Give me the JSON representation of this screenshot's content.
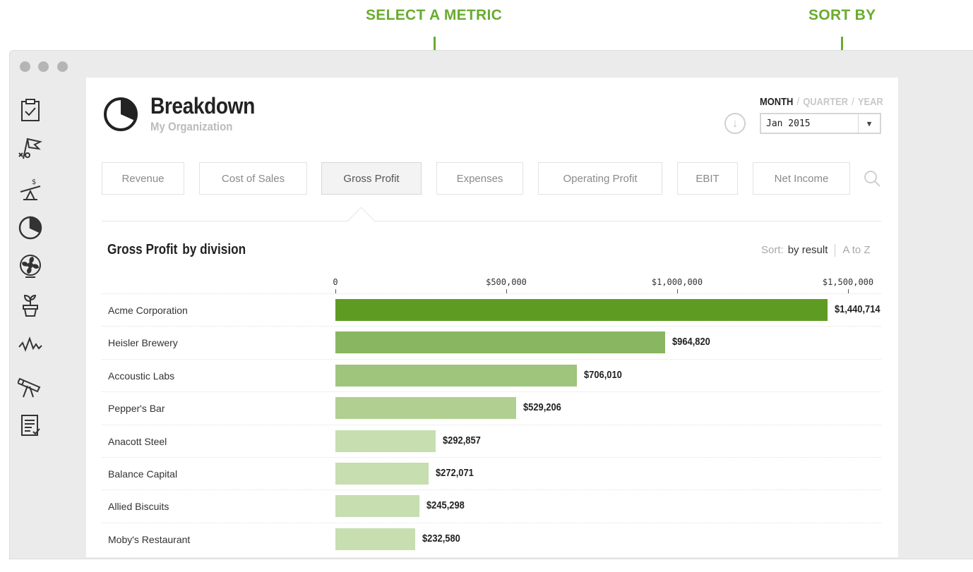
{
  "callouts": {
    "metric": "SELECT A  METRIC",
    "sort": "SORT BY"
  },
  "header": {
    "title": "Breakdown",
    "subtitle": "My Organization"
  },
  "period": {
    "month": "MONTH",
    "quarter": "QUARTER",
    "year": "YEAR",
    "separator": "/",
    "selected_date": "Jan 2015"
  },
  "tabs": [
    {
      "label": "Revenue",
      "active": false
    },
    {
      "label": "Cost of Sales",
      "active": false
    },
    {
      "label": "Gross Profit",
      "active": true
    },
    {
      "label": "Expenses",
      "active": false
    },
    {
      "label": "Operating Profit",
      "active": false
    },
    {
      "label": "EBIT",
      "active": false
    },
    {
      "label": "Net Income",
      "active": false
    }
  ],
  "section": {
    "metric": "Gross Profit",
    "by": "by division"
  },
  "sort": {
    "label": "Sort:",
    "current": "by result",
    "alternative": "A to Z"
  },
  "sidebar_icons": [
    "checklist-icon",
    "strategy-icon",
    "balance-icon",
    "pie-chart-icon",
    "fan-icon",
    "plant-icon",
    "pulse-icon",
    "telescope-icon",
    "report-icon"
  ],
  "colors": {
    "accent": "#6aab2e",
    "bar_shades": [
      "#5e9b23",
      "#89b661",
      "#9fc47c",
      "#b0cf90",
      "#c6deb0",
      "#c6deb0",
      "#c6deb0",
      "#c6deb0"
    ]
  },
  "chart_data": {
    "type": "bar",
    "orientation": "horizontal",
    "categories": [
      "Acme Corporation",
      "Heisler Brewery",
      "Accoustic Labs",
      "Pepper's Bar",
      "Anacott Steel",
      "Balance Capital",
      "Allied Biscuits",
      "Moby's Restaurant"
    ],
    "values": [
      1440714,
      964820,
      706010,
      529206,
      292857,
      272071,
      245298,
      232580
    ],
    "value_labels": [
      "$1,440,714",
      "$964,820",
      "$706,010",
      "$529,206",
      "$292,857",
      "$272,071",
      "$245,298",
      "$232,580"
    ],
    "ticks": [
      0,
      500000,
      1000000,
      1500000
    ],
    "tick_labels": [
      "0",
      "$500,000",
      "$1,000,000",
      "$1,500,000"
    ],
    "xlim": [
      0,
      1600000
    ]
  }
}
